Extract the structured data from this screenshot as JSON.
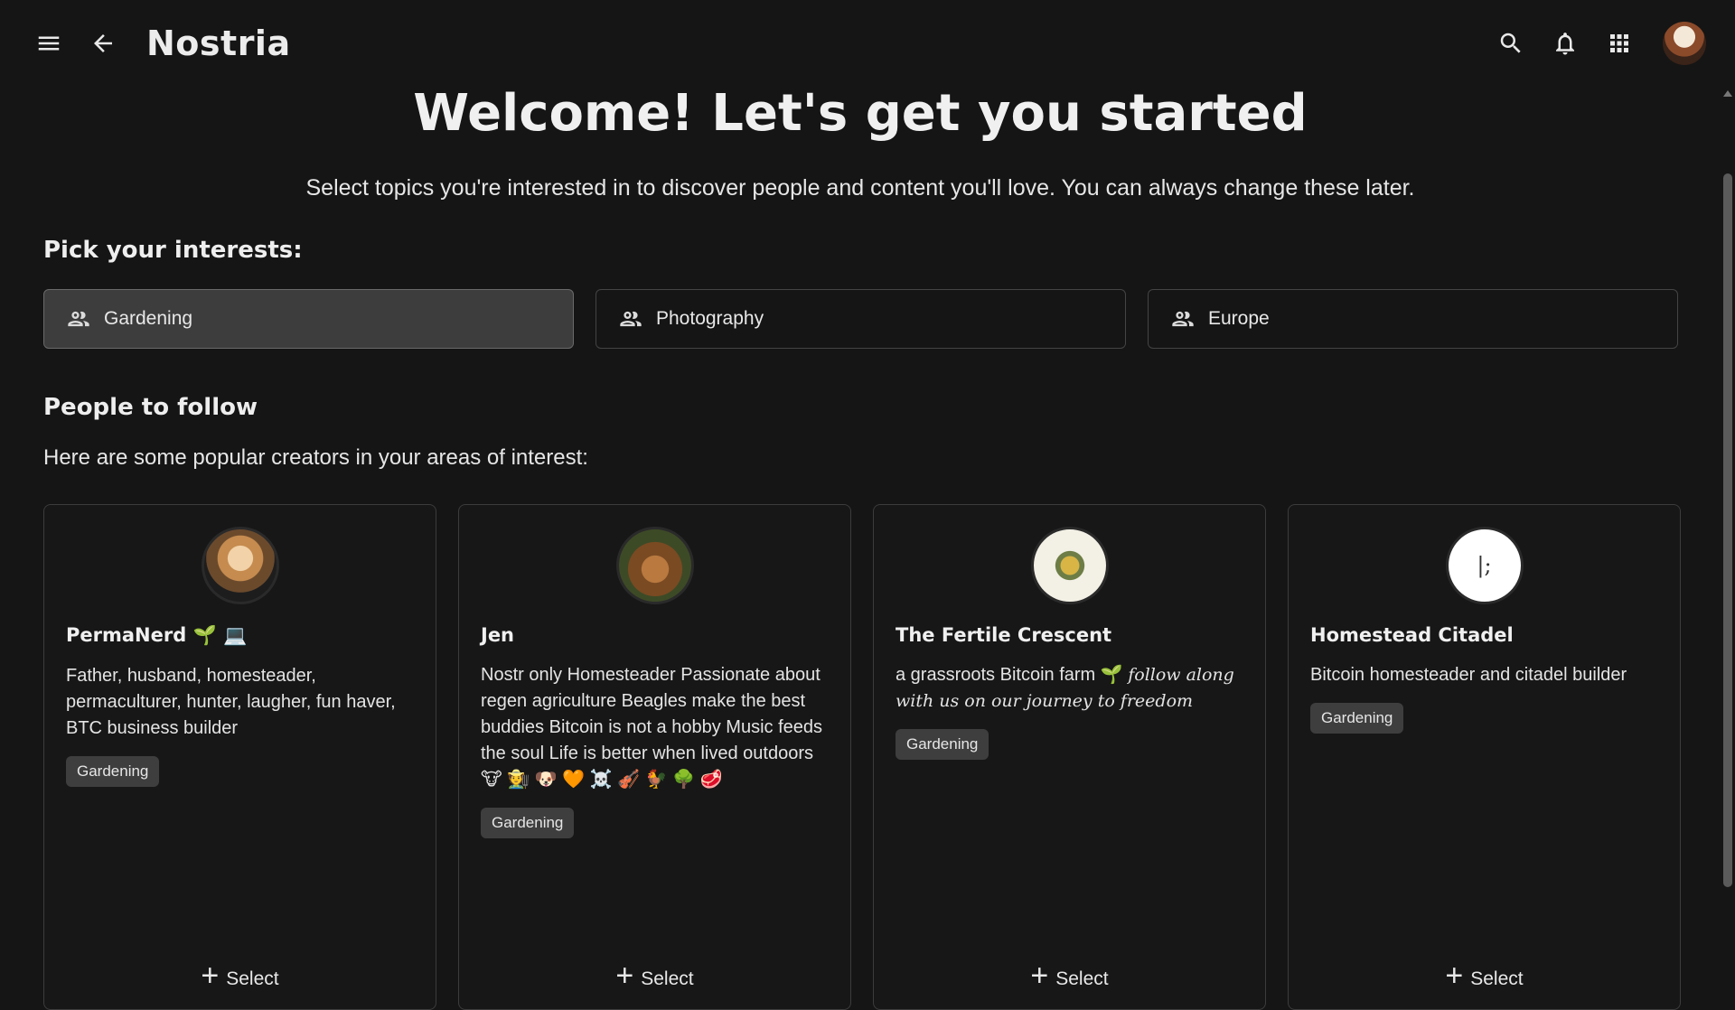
{
  "header": {
    "app_title": "Nostria",
    "icons": [
      "menu-icon",
      "back-arrow-icon",
      "search-icon",
      "notifications-icon",
      "apps-grid-icon"
    ]
  },
  "hero": {
    "title": "Welcome! Let's get you started",
    "subtitle": "Select topics you're interested in to discover people and content you'll love. You can always change these later."
  },
  "interests": {
    "title": "Pick your interests:",
    "items": [
      {
        "label": "Gardening",
        "selected": true
      },
      {
        "label": "Photography",
        "selected": false
      },
      {
        "label": "Europe",
        "selected": false
      }
    ]
  },
  "follow": {
    "title": "People to follow",
    "subtitle": "Here are some popular creators in your areas of interest:",
    "cards": [
      {
        "name": "PermaNerd 🌱 💻",
        "bio": "Father, husband, homesteader, permaculturer, hunter, laugher, fun haver, BTC business builder",
        "tag": "Gardening",
        "select_label": "Select"
      },
      {
        "name": "Jen",
        "bio": "Nostr only Homesteader Passionate about regen agriculture Beagles make the best buddies Bitcoin is not a hobby Music feeds the soul Life is better when lived outdoors 🐮 🧑‍🌾 🐶 🧡 ☠️ 🎻 🐓 🌳 🥩",
        "tag": "Gardening",
        "select_label": "Select"
      },
      {
        "name": "The Fertile Crescent",
        "bio_plain": "a grassroots Bitcoin farm 🌱 ",
        "bio_italic": "follow along with us on our journey to freedom",
        "tag": "Gardening",
        "select_label": "Select"
      },
      {
        "name": "Homestead Citadel",
        "bio": "Bitcoin homesteader and citadel builder",
        "tag": "Gardening",
        "select_label": "Select"
      }
    ]
  },
  "colors": {
    "background": "#151515",
    "card_border": "#3c3c3c",
    "selected_interest": "#3d3d3d",
    "tag_bg": "#3e3e3e"
  }
}
